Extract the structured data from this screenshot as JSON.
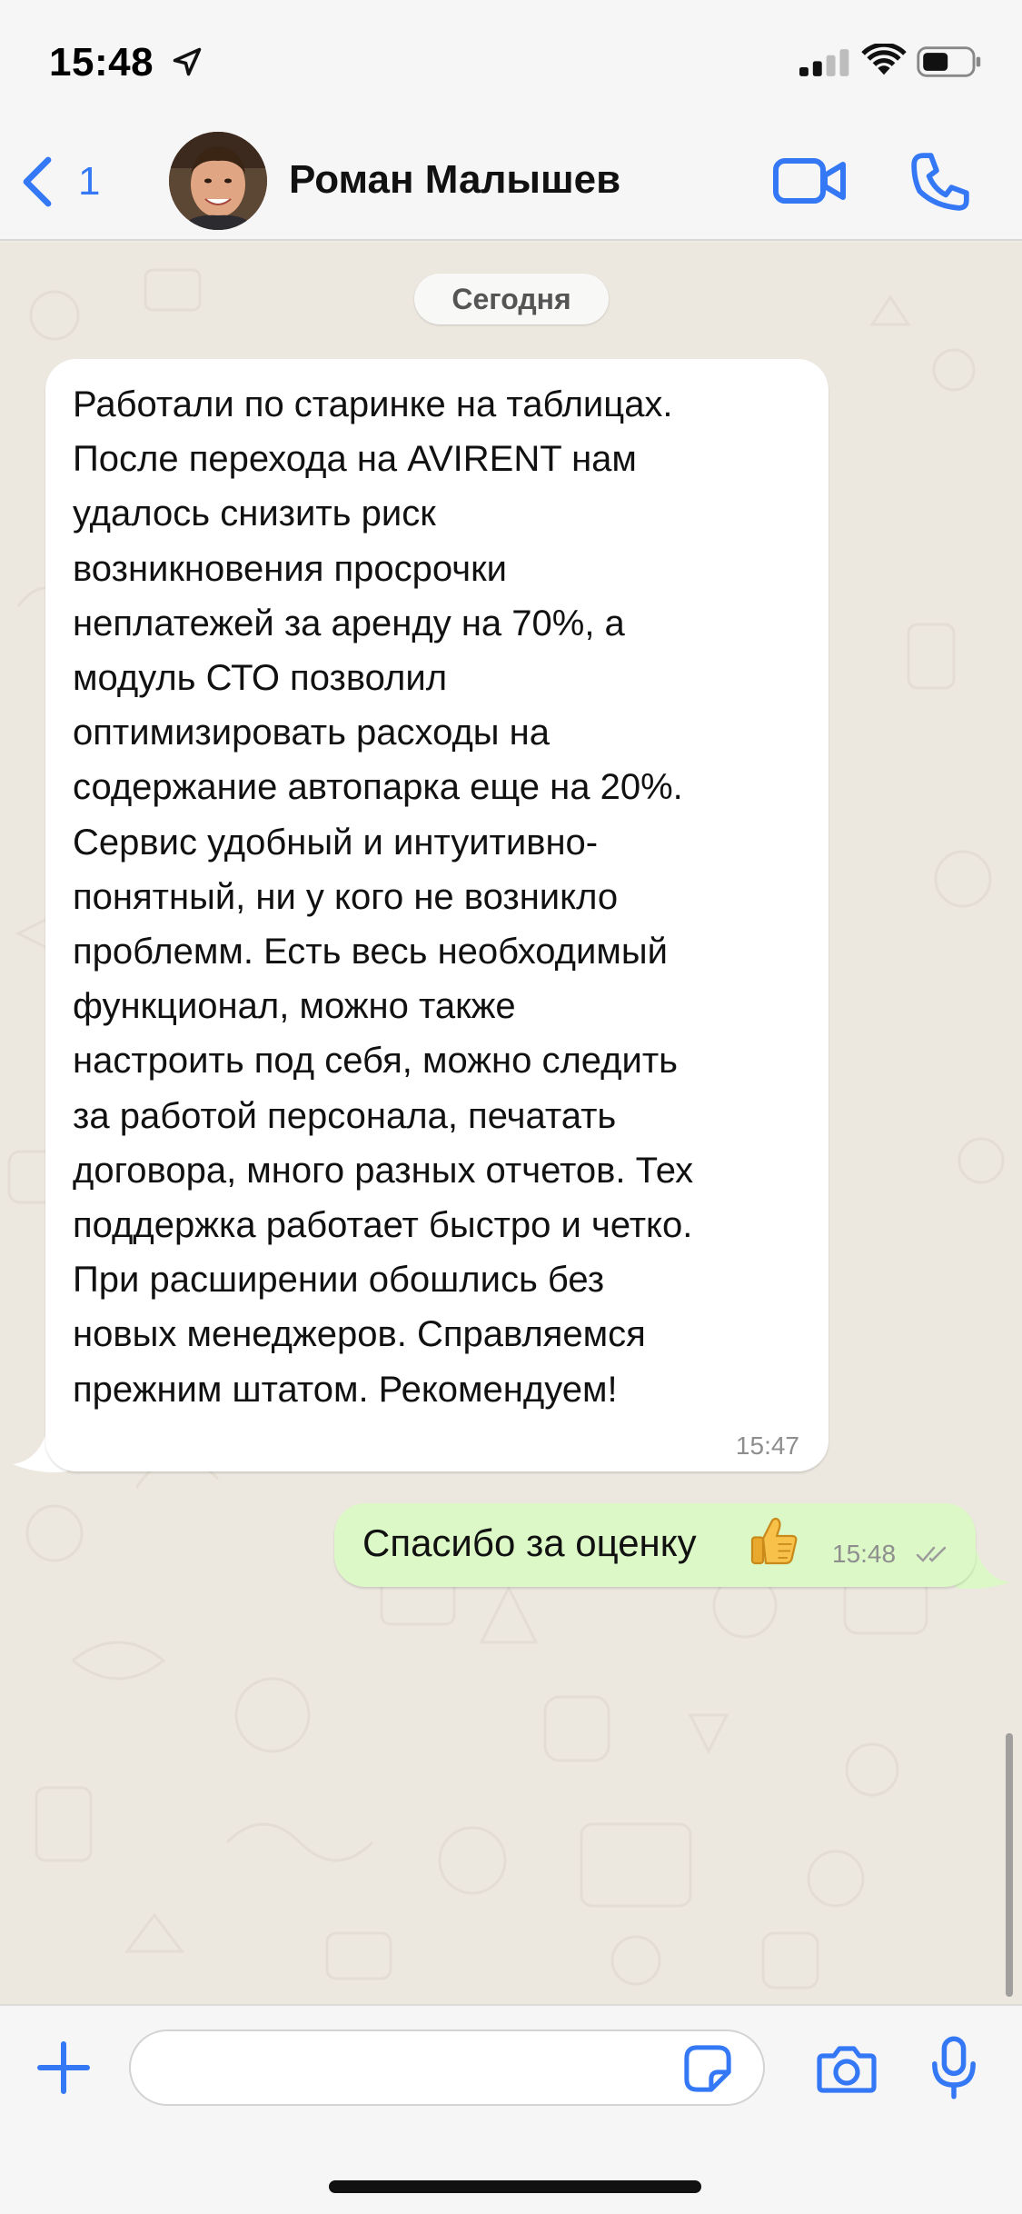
{
  "status_bar": {
    "time": "15:48",
    "icons": [
      "location-arrow-icon",
      "cellular-signal-icon",
      "wifi-icon",
      "battery-icon"
    ]
  },
  "header": {
    "back_count": "1",
    "contact_name": "Роман Малышев",
    "icons": [
      "chevron-left-icon",
      "video-camera-icon",
      "phone-icon"
    ],
    "accent_color": "#3478f6"
  },
  "chat": {
    "date_label": "Сегодня",
    "incoming_message": {
      "lines": [
        "Работали по старинке на таблицах.",
        "После перехода на AVIRENT нам",
        "удалось снизить риск",
        "возникновения просрочки",
        "неплатежей за аренду на 70%, а",
        "модуль СТО позволил",
        "оптимизировать расходы на",
        "содержание автопарка еще на 20%.",
        "Сервис удобный и интуитивно-",
        "понятный, ни у кого не возникло",
        "проблемм. Есть весь необходимый",
        "функционал, можно также",
        "настроить под себя, можно следить",
        "за работой персонала, печатать",
        "договора, много разных отчетов. Тех",
        "поддержка работает быстро и четко.",
        "При расширении обошлись без",
        "новых менеджеров. Справляемся",
        "прежним штатом. Рекомендуем!"
      ],
      "time": "15:47",
      "bubble_color": "#ffffff"
    },
    "outgoing_message": {
      "text": "Спасибо за оценку",
      "emoji": "thumbs-up-icon",
      "time": "15:48",
      "status_icon": "double-check-icon",
      "bubble_color": "#dcf8c6"
    }
  },
  "input_bar": {
    "placeholder": "",
    "icons": [
      "plus-icon",
      "sticker-icon",
      "camera-icon",
      "microphone-icon"
    ]
  }
}
